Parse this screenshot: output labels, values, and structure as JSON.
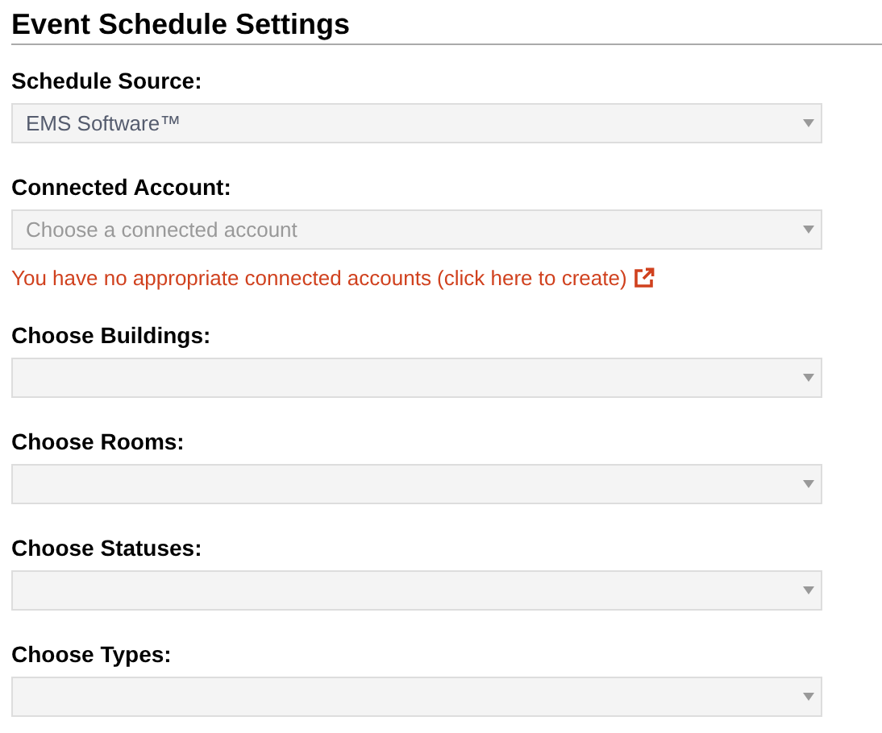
{
  "heading": "Event Schedule Settings",
  "fields": [
    {
      "label": "Schedule Source:",
      "value": "EMS Software™"
    },
    {
      "label": "Connected Account:",
      "placeholder": "Choose a connected account",
      "error_link": "You have no appropriate connected accounts (click here to create)"
    },
    {
      "label": "Choose Buildings:"
    },
    {
      "label": "Choose Rooms:"
    },
    {
      "label": "Choose Statuses:"
    },
    {
      "label": "Choose Types:"
    }
  ]
}
